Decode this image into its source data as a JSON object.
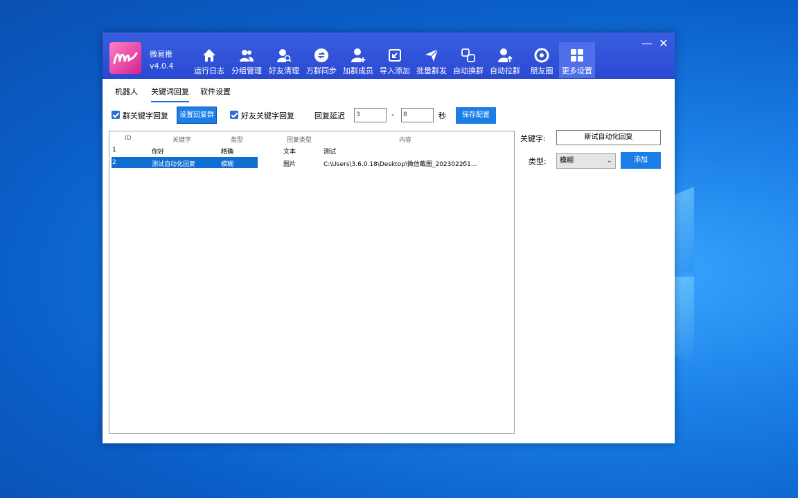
{
  "app": {
    "name": "微易推",
    "version": "v4.0.4"
  },
  "toolbar": [
    {
      "label": "运行日志",
      "icon": "home-icon"
    },
    {
      "label": "分组管理",
      "icon": "users-icon"
    },
    {
      "label": "好友清理",
      "icon": "user-search-icon"
    },
    {
      "label": "万群同步",
      "icon": "sync-icon"
    },
    {
      "label": "加群成员",
      "icon": "user-add-icon"
    },
    {
      "label": "导入添加",
      "icon": "import-icon"
    },
    {
      "label": "批量群发",
      "icon": "send-icon"
    },
    {
      "label": "自动换群",
      "icon": "swap-icon"
    },
    {
      "label": "自动拉群",
      "icon": "user-pull-icon"
    },
    {
      "label": "朋友圈",
      "icon": "aperture-icon"
    },
    {
      "label": "更多设置",
      "icon": "grid-icon"
    }
  ],
  "window_controls": {
    "minimize": "—",
    "close": "✕"
  },
  "subtabs": [
    "机器人",
    "关键词回复",
    "软件设置"
  ],
  "active_subtab": "关键词回复",
  "options": {
    "group_keyword_reply": {
      "label": "群关键字回复",
      "checked": true
    },
    "set_reply_group_button": "设置回复群",
    "friend_keyword_reply": {
      "label": "好友关键字回复",
      "checked": true
    },
    "reply_delay_label": "回复延迟",
    "delay_min": "3",
    "delay_sep": "-",
    "delay_max": "8",
    "delay_unit": "秒",
    "save_button": "保存配置"
  },
  "grid": {
    "columns": [
      "ID",
      "关键字",
      "类型",
      "回复类型",
      "内容"
    ],
    "rows": [
      {
        "id": "1",
        "keyword": "你好",
        "type": "精确",
        "reply_type": "文本",
        "content": "测试"
      },
      {
        "id": "2",
        "keyword": "测试自动化回复",
        "type": "模糊",
        "reply_type": "图片",
        "content": "C:\\Users\\3.6.0.18\\Desktop\\微信截图_2023022б1..."
      }
    ],
    "selected_row": 1
  },
  "form": {
    "keyword_label": "关键字:",
    "keyword_value": "斯试自动化回复",
    "type_label": "类型:",
    "type_value": "模糊",
    "add_button": "添加"
  },
  "colors": {
    "titlebar": "#2a49d2",
    "accent": "#1a7ee6",
    "selection": "#0e6fd1"
  }
}
